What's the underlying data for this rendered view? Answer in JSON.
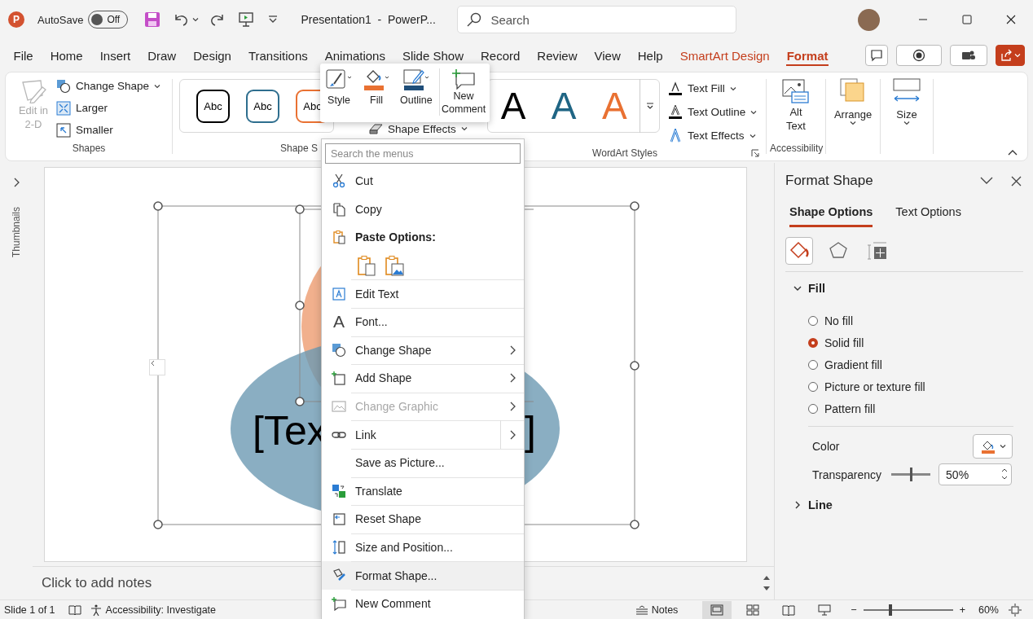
{
  "title_bar": {
    "logo": "P",
    "autosave_label": "AutoSave",
    "autosave": {
      "on": false,
      "label": "Off"
    },
    "title": "Presentation1  -  PowerP...",
    "search": {
      "placeholder": "Search"
    }
  },
  "tabs": [
    {
      "label": "File",
      "kind": "standard",
      "selected": false
    },
    {
      "label": "Home",
      "kind": "standard",
      "selected": false
    },
    {
      "label": "Insert",
      "kind": "standard",
      "selected": false
    },
    {
      "label": "Draw",
      "kind": "standard",
      "selected": false
    },
    {
      "label": "Design",
      "kind": "standard",
      "selected": false
    },
    {
      "label": "Transitions",
      "kind": "standard",
      "selected": false
    },
    {
      "label": "Animations",
      "kind": "standard",
      "selected": false
    },
    {
      "label": "Slide Show",
      "kind": "standard",
      "selected": false
    },
    {
      "label": "Record",
      "kind": "standard",
      "selected": false
    },
    {
      "label": "Review",
      "kind": "standard",
      "selected": false
    },
    {
      "label": "View",
      "kind": "standard",
      "selected": false
    },
    {
      "label": "Help",
      "kind": "standard",
      "selected": false
    },
    {
      "label": "SmartArt Design",
      "kind": "contextual",
      "selected": false
    },
    {
      "label": "Format",
      "kind": "contextual",
      "selected": true
    }
  ],
  "ribbon": {
    "shapes": {
      "edit": {
        "label": "Edit in 2-D",
        "disabled": true
      },
      "buttons": [
        "Change Shape",
        "Larger",
        "Smaller"
      ],
      "label": "Shapes"
    },
    "shape_styles": {
      "presets": [
        {
          "label": "Abc",
          "color": "#000000"
        },
        {
          "label": "Abc",
          "color": "#2e6e8e"
        },
        {
          "label": "Abc",
          "color": "#e97132"
        }
      ],
      "effects": "Shape Effects",
      "label": "Shape S"
    },
    "wordart": {
      "presets": [
        {
          "label": "A",
          "color": "#000000"
        },
        {
          "label": "A",
          "color": "#1f6584"
        },
        {
          "label": "A",
          "color": "#e97132"
        }
      ],
      "buttons": [
        "Text Fill",
        "Text Outline",
        "Text Effects"
      ],
      "label": "WordArt Styles"
    },
    "accessibility": {
      "button": "Alt Text",
      "label": "Accessibility"
    },
    "arrange": "Arrange",
    "size": "Size"
  },
  "mini_toolbar": [
    "Style",
    "Fill",
    "Outline",
    "New Comment"
  ],
  "thumbnails_label": "Thumbnails",
  "slide": {
    "text_left": "[Tex",
    "text_right": "]",
    "notes_placeholder": "Click to add notes"
  },
  "context_menu": {
    "search": {
      "placeholder": "Search the menus"
    },
    "items": [
      {
        "label": "Cut",
        "kind": "item",
        "submenu": false,
        "split": false,
        "disabled": false,
        "highlighted": false,
        "divider": false
      },
      {
        "label": "Copy",
        "kind": "item",
        "submenu": false,
        "split": false,
        "disabled": false,
        "highlighted": false,
        "divider": false
      },
      {
        "label": "Paste Options:",
        "kind": "header",
        "submenu": false,
        "split": false,
        "disabled": false,
        "highlighted": false,
        "divider": false
      },
      {
        "kind": "paste_icons"
      },
      {
        "label": "Edit Text",
        "kind": "item",
        "submenu": false,
        "split": false,
        "disabled": false,
        "highlighted": false,
        "divider": true
      },
      {
        "label": "Font...",
        "kind": "item",
        "glyph": "A",
        "submenu": false,
        "split": false,
        "disabled": false,
        "highlighted": false,
        "divider": true
      },
      {
        "label": "Change Shape",
        "kind": "item",
        "submenu": true,
        "split": false,
        "disabled": false,
        "highlighted": false,
        "divider": true
      },
      {
        "label": "Add Shape",
        "kind": "item",
        "submenu": true,
        "split": false,
        "disabled": false,
        "highlighted": false,
        "divider": true
      },
      {
        "label": "Change Graphic",
        "kind": "item",
        "submenu": true,
        "split": false,
        "disabled": true,
        "highlighted": false,
        "divider": true
      },
      {
        "label": "Link",
        "kind": "item",
        "submenu": true,
        "split": true,
        "disabled": false,
        "highlighted": false,
        "divider": true
      },
      {
        "label": "Save as Picture...",
        "kind": "item",
        "submenu": false,
        "split": false,
        "disabled": false,
        "highlighted": false,
        "divider": true
      },
      {
        "label": "Translate",
        "kind": "item",
        "submenu": false,
        "split": false,
        "disabled": false,
        "highlighted": false,
        "divider": true
      },
      {
        "label": "Reset Shape",
        "kind": "item",
        "submenu": false,
        "split": false,
        "disabled": false,
        "highlighted": false,
        "divider": true
      },
      {
        "label": "Size and Position...",
        "kind": "item",
        "submenu": false,
        "split": false,
        "disabled": false,
        "highlighted": false,
        "divider": true
      },
      {
        "label": "Format Shape...",
        "kind": "item",
        "submenu": false,
        "split": false,
        "disabled": false,
        "highlighted": true,
        "divider": true
      },
      {
        "label": "New Comment",
        "kind": "item",
        "submenu": false,
        "split": false,
        "disabled": false,
        "highlighted": false,
        "divider": true
      }
    ]
  },
  "format_pane": {
    "title": "Format Shape",
    "tabs": [
      {
        "label": "Shape Options",
        "selected": true
      },
      {
        "label": "Text Options",
        "selected": false
      }
    ],
    "icon_tabs": [
      {
        "selected": true
      },
      {
        "selected": false
      },
      {
        "selected": false
      }
    ],
    "sections": [
      {
        "label": "Fill",
        "expanded": true,
        "options": [
          {
            "label": "No fill",
            "selected": false
          },
          {
            "label": "Solid fill",
            "selected": true
          },
          {
            "label": "Gradient fill",
            "selected": false
          },
          {
            "label": "Picture or texture fill",
            "selected": false
          },
          {
            "label": "Pattern fill",
            "selected": false
          }
        ],
        "color_label": "Color",
        "transparency": {
          "label": "Transparency",
          "level": 0.5,
          "value": "50%"
        }
      },
      {
        "label": "Line",
        "expanded": false
      }
    ]
  },
  "status_bar": {
    "slide": "Slide 1 of 1",
    "accessibility": "Accessibility: Investigate",
    "notes": "Notes",
    "views": [
      {
        "selected": true
      },
      {
        "selected": false
      },
      {
        "selected": false
      },
      {
        "selected": false
      }
    ],
    "zoom_minus": "−",
    "zoom_plus": "+",
    "zoom": {
      "level": 0.3,
      "value": "60%"
    }
  }
}
